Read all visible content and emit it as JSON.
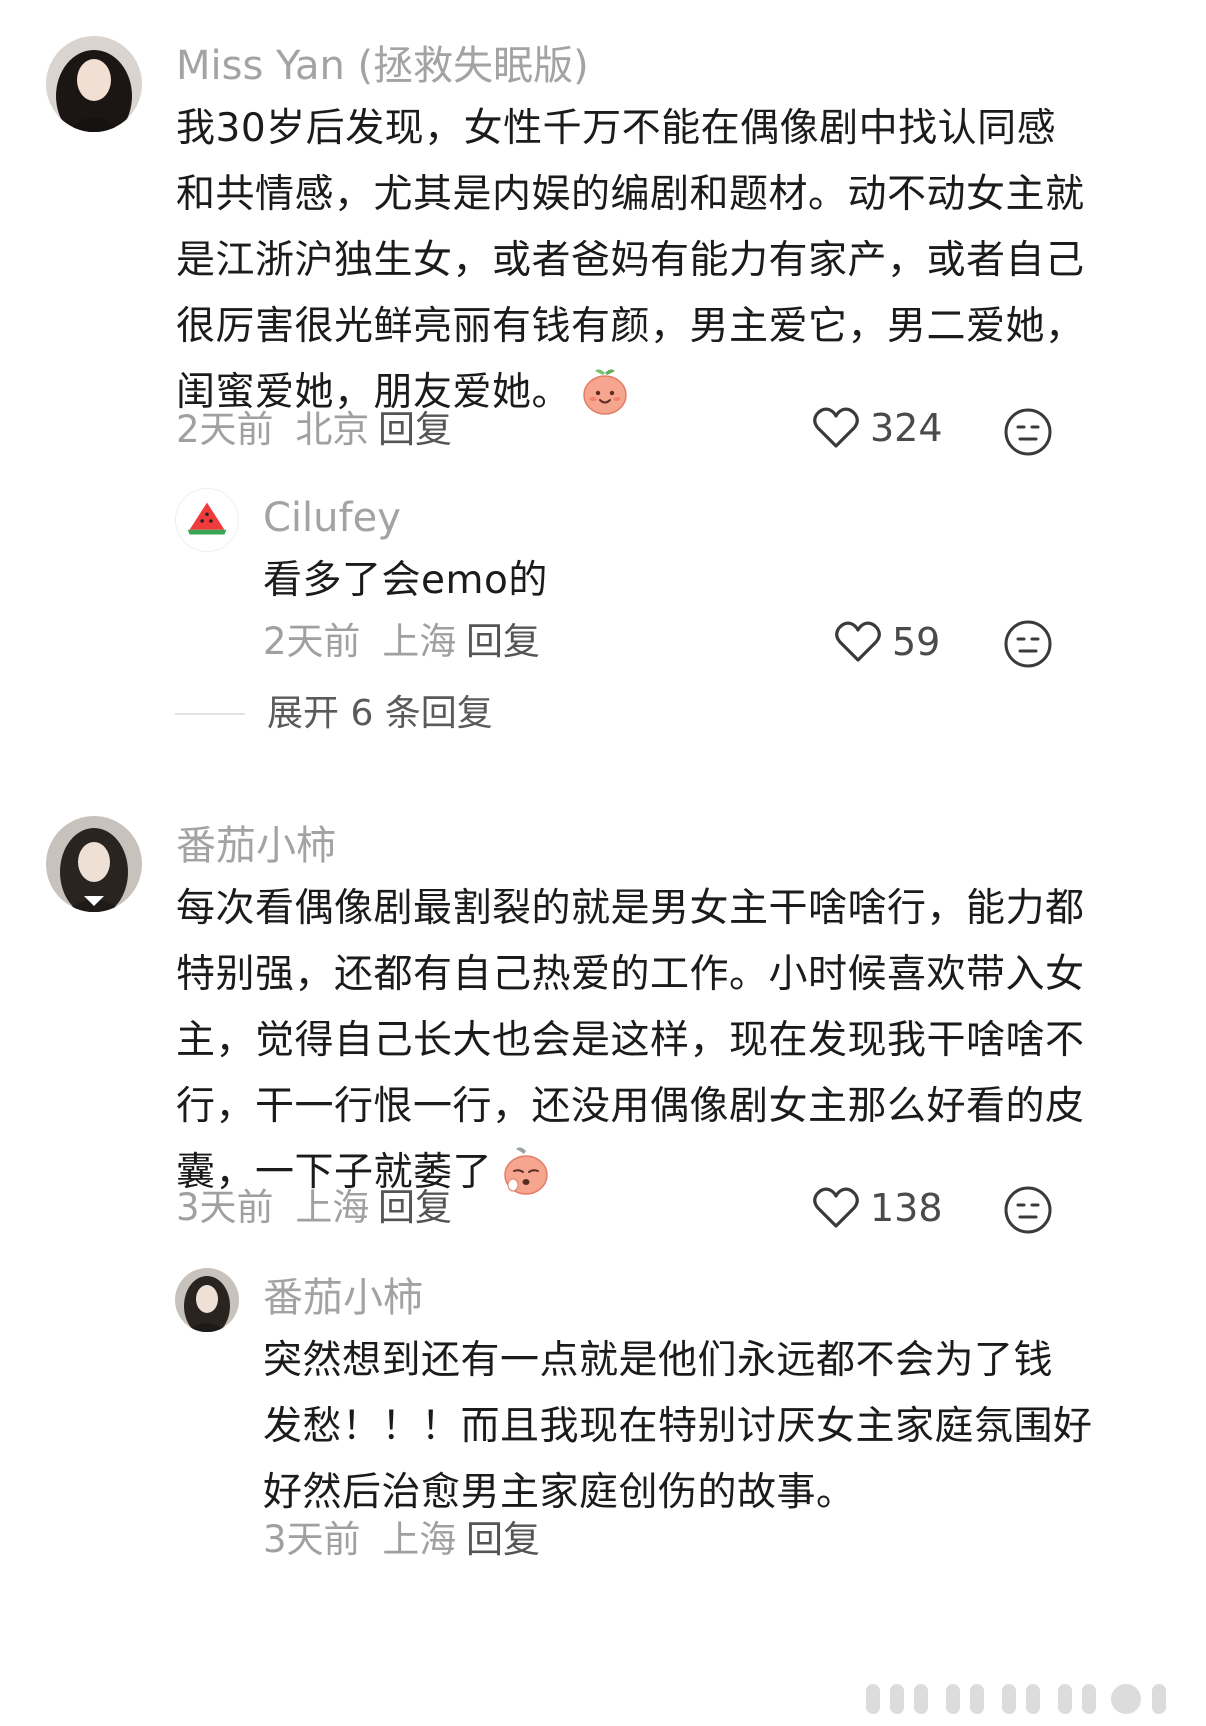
{
  "comments": [
    {
      "username": "Miss Yan (拯救失眠版)",
      "lines": [
        "我30岁后发现，女性千万不能在偶像剧中找认同感",
        "和共情感，尤其是内娱的编剧和题材。动不动女主就",
        "是江浙沪独生女，或者爸妈有能力有家产，或者自己",
        "很厉害很光鲜亮丽有钱有颜，男主爱它，男二爱她，",
        "闺蜜爱她，朋友爱她。"
      ],
      "time": "2天前",
      "location": "北京",
      "reply_label": "回复",
      "likes": "324",
      "emoji": "smiling-peach-emoji"
    },
    {
      "username": "Cilufey",
      "lines": [
        "看多了会emo的"
      ],
      "time": "2天前",
      "location": "上海",
      "reply_label": "回复",
      "likes": "59"
    },
    {
      "username": "番茄小柿",
      "lines": [
        "每次看偶像剧最割裂的就是男女主干啥啥行，能力都",
        "特别强，还都有自己热爱的工作。小时候喜欢带入女",
        "主，觉得自己长大也会是这样，现在发现我干啥啥不",
        "行，干一行恨一行，还没用偶像剧女主那么好看的皮",
        "囊，一下子就萎了"
      ],
      "time": "3天前",
      "location": "上海",
      "reply_label": "回复",
      "likes": "138",
      "emoji": "sad-peach-emoji"
    },
    {
      "username": "番茄小柿",
      "lines": [
        "突然想到还有一点就是他们永远都不会为了钱",
        "发愁！！！而且我现在特别讨厌女主家庭氛围好",
        "好然后治愈男主家庭创伤的故事。"
      ],
      "time": "3天前",
      "location": "上海",
      "reply_label": "回复"
    }
  ],
  "expand_replies": "展开 6 条回复",
  "icons": {
    "like": "heart-outline-icon",
    "dislike": "neutral-face-icon"
  },
  "colors": {
    "username": "#a3a3a3",
    "body": "#1b1b1b",
    "meta": "#a0a0a0",
    "peach": "#f6a58f"
  }
}
